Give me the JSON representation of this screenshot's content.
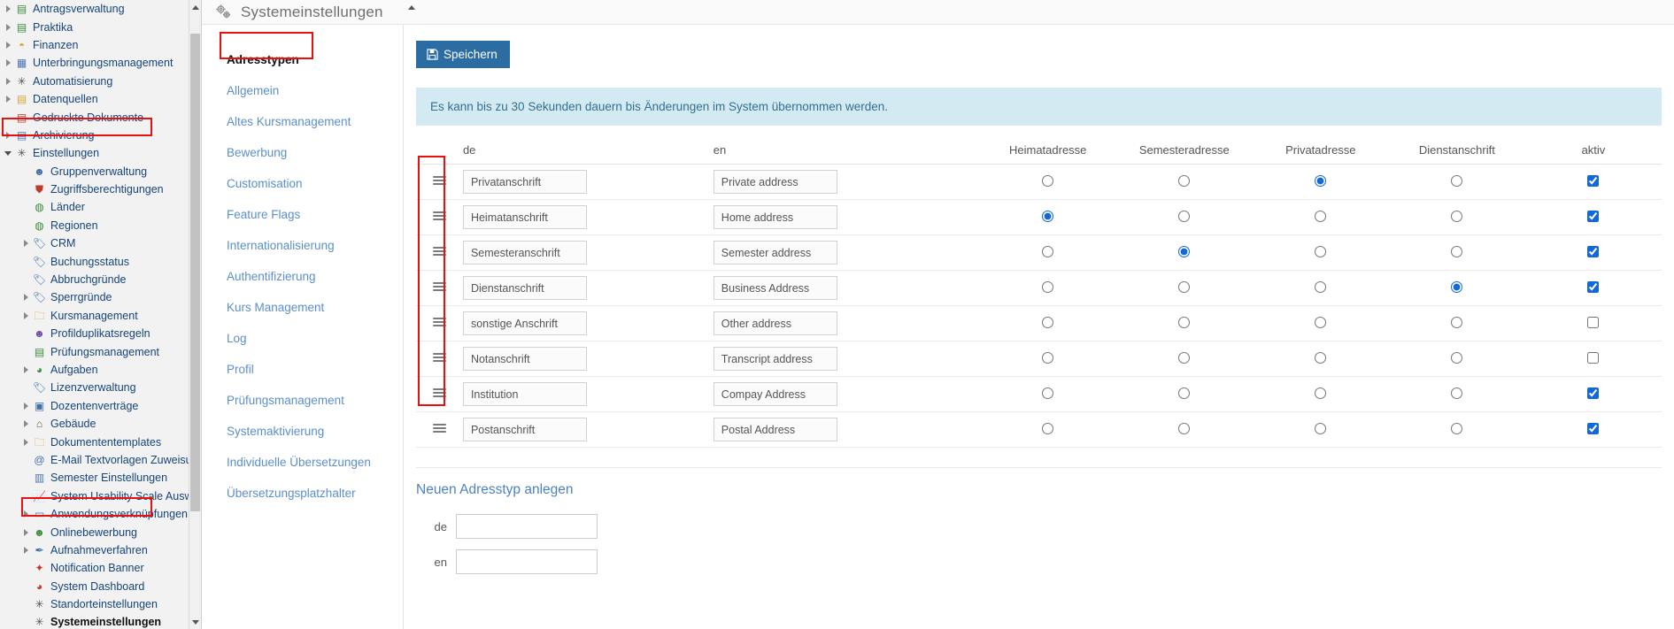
{
  "sidebar": {
    "items": [
      {
        "label": "Antragsverwaltung",
        "icon": "form-users-icon",
        "indent": 0,
        "twisty": "closed",
        "bold": false,
        "glyph": "▤",
        "color": "#3c8c3c"
      },
      {
        "label": "Praktika",
        "icon": "form-users-icon",
        "indent": 0,
        "twisty": "closed",
        "bold": false,
        "glyph": "▤",
        "color": "#3c8c3c"
      },
      {
        "label": "Finanzen",
        "icon": "coins-icon",
        "indent": 0,
        "twisty": "closed",
        "bold": false,
        "glyph": "◓",
        "color": "#d8a13a"
      },
      {
        "label": "Unterbringungsmanagement",
        "icon": "building-icon",
        "indent": 0,
        "twisty": "closed",
        "bold": false,
        "glyph": "▦",
        "color": "#4a73b5"
      },
      {
        "label": "Automatisierung",
        "icon": "gear-icon",
        "indent": 0,
        "twisty": "closed",
        "bold": false,
        "glyph": "✳",
        "color": "#555555"
      },
      {
        "label": "Datenquellen",
        "icon": "database-icon",
        "indent": 0,
        "twisty": "closed",
        "bold": false,
        "glyph": "▤",
        "color": "#d8a13a"
      },
      {
        "label": "Gedruckte Dokumente",
        "icon": "document-icon",
        "indent": 0,
        "twisty": "none",
        "bold": false,
        "glyph": "▤",
        "color": "#c0392b"
      },
      {
        "label": "Archivierung",
        "icon": "archive-card-icon",
        "indent": 0,
        "twisty": "closed",
        "bold": false,
        "glyph": "▤",
        "color": "#4a73b5"
      },
      {
        "label": "Einstellungen",
        "icon": "gear-icon",
        "indent": 0,
        "twisty": "open",
        "bold": false,
        "glyph": "✳",
        "color": "#555555"
      },
      {
        "label": "Gruppenverwaltung",
        "icon": "user-group-icon",
        "indent": 1,
        "twisty": "none",
        "bold": false,
        "glyph": "☻",
        "color": "#3f6fa8"
      },
      {
        "label": "Zugriffsberechtigungen",
        "icon": "shield-icon",
        "indent": 1,
        "twisty": "none",
        "bold": false,
        "glyph": "⛊",
        "color": "#c0392b"
      },
      {
        "label": "Länder",
        "icon": "globe-icon",
        "indent": 1,
        "twisty": "none",
        "bold": false,
        "glyph": "◍",
        "color": "#3c8c3c"
      },
      {
        "label": "Regionen",
        "icon": "globe-region-icon",
        "indent": 1,
        "twisty": "none",
        "bold": false,
        "glyph": "◍",
        "color": "#3c8c3c"
      },
      {
        "label": "CRM",
        "icon": "tag-icon",
        "indent": 1,
        "twisty": "closed",
        "bold": false,
        "glyph": "🏷",
        "color": "#3f6fa8"
      },
      {
        "label": "Buchungsstatus",
        "icon": "tag-icon",
        "indent": 1,
        "twisty": "none",
        "bold": false,
        "glyph": "🏷",
        "color": "#3f6fa8"
      },
      {
        "label": "Abbruchgründe",
        "icon": "tag-icon",
        "indent": 1,
        "twisty": "none",
        "bold": false,
        "glyph": "🏷",
        "color": "#3f6fa8"
      },
      {
        "label": "Sperrgründe",
        "icon": "tag-icon",
        "indent": 1,
        "twisty": "closed",
        "bold": false,
        "glyph": "🏷",
        "color": "#3f6fa8"
      },
      {
        "label": "Kursmanagement",
        "icon": "folder-icon",
        "indent": 1,
        "twisty": "closed",
        "bold": false,
        "glyph": "🗀",
        "color": "#d8a13a"
      },
      {
        "label": "Profilduplikatsregeln",
        "icon": "user-settings-icon",
        "indent": 1,
        "twisty": "none",
        "bold": false,
        "glyph": "☻",
        "color": "#6a4fa0"
      },
      {
        "label": "Prüfungsmanagement",
        "icon": "exam-chart-icon",
        "indent": 1,
        "twisty": "none",
        "bold": false,
        "glyph": "▤",
        "color": "#3c8c3c"
      },
      {
        "label": "Aufgaben",
        "icon": "clock-history-icon",
        "indent": 1,
        "twisty": "closed",
        "bold": false,
        "glyph": "◕",
        "color": "#3c8c3c"
      },
      {
        "label": "Lizenzverwaltung",
        "icon": "tag-icon",
        "indent": 1,
        "twisty": "none",
        "bold": false,
        "glyph": "🏷",
        "color": "#3f6fa8"
      },
      {
        "label": "Dozentenverträge",
        "icon": "contract-icon",
        "indent": 1,
        "twisty": "closed",
        "bold": false,
        "glyph": "▣",
        "color": "#3f6fa8"
      },
      {
        "label": "Gebäude",
        "icon": "home-icon",
        "indent": 1,
        "twisty": "closed",
        "bold": false,
        "glyph": "⌂",
        "color": "#555555"
      },
      {
        "label": "Dokumententemplates",
        "icon": "folder-icon",
        "indent": 1,
        "twisty": "closed",
        "bold": false,
        "glyph": "🗀",
        "color": "#d8a13a"
      },
      {
        "label": "E-Mail Textvorlagen Zuweisung",
        "icon": "at-icon",
        "indent": 1,
        "twisty": "none",
        "bold": false,
        "glyph": "@",
        "color": "#3f6fa8"
      },
      {
        "label": "Semester Einstellungen",
        "icon": "calendar-icon",
        "indent": 1,
        "twisty": "none",
        "bold": false,
        "glyph": "▥",
        "color": "#4a73b5"
      },
      {
        "label": "System Usability Scale Auswertung",
        "icon": "chart-line-icon",
        "indent": 1,
        "twisty": "none",
        "bold": false,
        "glyph": "📈",
        "color": "#3f6fa8"
      },
      {
        "label": "Anwendungsverknüpfungen",
        "icon": "app-link-icon",
        "indent": 1,
        "twisty": "closed",
        "bold": false,
        "glyph": "▭",
        "color": "#4a73b5"
      },
      {
        "label": "Onlinebewerbung",
        "icon": "person-apply-icon",
        "indent": 1,
        "twisty": "closed",
        "bold": false,
        "glyph": "☻",
        "color": "#3c8c3c"
      },
      {
        "label": "Aufnahmeverfahren",
        "icon": "graduation-cap-icon",
        "indent": 1,
        "twisty": "closed",
        "bold": false,
        "glyph": "✒",
        "color": "#3f6fa8"
      },
      {
        "label": "Notification Banner",
        "icon": "megaphone-icon",
        "indent": 1,
        "twisty": "none",
        "bold": false,
        "glyph": "✦",
        "color": "#c0392b"
      },
      {
        "label": "System Dashboard",
        "icon": "dashboard-icon",
        "indent": 1,
        "twisty": "none",
        "bold": false,
        "glyph": "◕",
        "color": "#c0392b"
      },
      {
        "label": "Standorteinstellungen",
        "icon": "gear-icon",
        "indent": 1,
        "twisty": "none",
        "bold": false,
        "glyph": "✳",
        "color": "#555555"
      },
      {
        "label": "Systemeinstellungen",
        "icon": "gear-icon",
        "indent": 1,
        "twisty": "none",
        "bold": true,
        "glyph": "✳",
        "color": "#555555"
      }
    ]
  },
  "header": {
    "title": "Systemeinstellungen",
    "icon": "gears-icon"
  },
  "subnav": {
    "items": [
      {
        "label": "Adresstypen",
        "active": true
      },
      {
        "label": "Allgemein",
        "active": false
      },
      {
        "label": "Altes Kursmanagement",
        "active": false
      },
      {
        "label": "Bewerbung",
        "active": false
      },
      {
        "label": "Customisation",
        "active": false
      },
      {
        "label": "Feature Flags",
        "active": false
      },
      {
        "label": "Internationalisierung",
        "active": false
      },
      {
        "label": "Authentifizierung",
        "active": false
      },
      {
        "label": "Kurs Management",
        "active": false
      },
      {
        "label": "Log",
        "active": false
      },
      {
        "label": "Profil",
        "active": false
      },
      {
        "label": "Prüfungsmanagement",
        "active": false
      },
      {
        "label": "Systemaktivierung",
        "active": false
      },
      {
        "label": "Individuelle Übersetzungen",
        "active": false
      },
      {
        "label": "Übersetzungsplatzhalter",
        "active": false
      }
    ]
  },
  "toolbar": {
    "save_label": "Speichern",
    "save_icon": "floppy-disk-icon"
  },
  "alert": {
    "message": "Es kann bis zu 30 Sekunden dauern bis Änderungen im System übernommen werden."
  },
  "table": {
    "headers": {
      "handle": "",
      "de": "de",
      "en": "en",
      "heimatadresse": "Heimatadresse",
      "semesteradresse": "Semesteradresse",
      "privatadresse": "Privatadresse",
      "dienstanschrift": "Dienstanschrift",
      "aktiv": "aktiv"
    },
    "rows": [
      {
        "de": "Privatanschrift",
        "en": "Private address",
        "heimat": false,
        "semester": false,
        "privat": true,
        "dienst": false,
        "aktiv": true
      },
      {
        "de": "Heimatanschrift",
        "en": "Home address",
        "heimat": true,
        "semester": false,
        "privat": false,
        "dienst": false,
        "aktiv": true
      },
      {
        "de": "Semesteranschrift",
        "en": "Semester address",
        "heimat": false,
        "semester": true,
        "privat": false,
        "dienst": false,
        "aktiv": true
      },
      {
        "de": "Dienstanschrift",
        "en": "Business Address",
        "heimat": false,
        "semester": false,
        "privat": false,
        "dienst": true,
        "aktiv": true
      },
      {
        "de": "sonstige Anschrift",
        "en": "Other address",
        "heimat": false,
        "semester": false,
        "privat": false,
        "dienst": false,
        "aktiv": false
      },
      {
        "de": "Notanschrift",
        "en": "Transcript address",
        "heimat": false,
        "semester": false,
        "privat": false,
        "dienst": false,
        "aktiv": false
      },
      {
        "de": "Institution",
        "en": "Compay Address",
        "heimat": false,
        "semester": false,
        "privat": false,
        "dienst": false,
        "aktiv": true
      },
      {
        "de": "Postanschrift",
        "en": "Postal Address",
        "heimat": false,
        "semester": false,
        "privat": false,
        "dienst": false,
        "aktiv": true
      }
    ]
  },
  "new_type": {
    "title": "Neuen Adresstyp anlegen",
    "de_label": "de",
    "en_label": "en",
    "de_value": "",
    "en_value": ""
  },
  "colors": {
    "accent": "#2b6ca3",
    "link": "#5b8fc9",
    "alert_bg": "#d4eaf3",
    "alert_fg": "#31708f",
    "radio_checked": "#1268d8",
    "highlight_box": "#e8110f"
  }
}
